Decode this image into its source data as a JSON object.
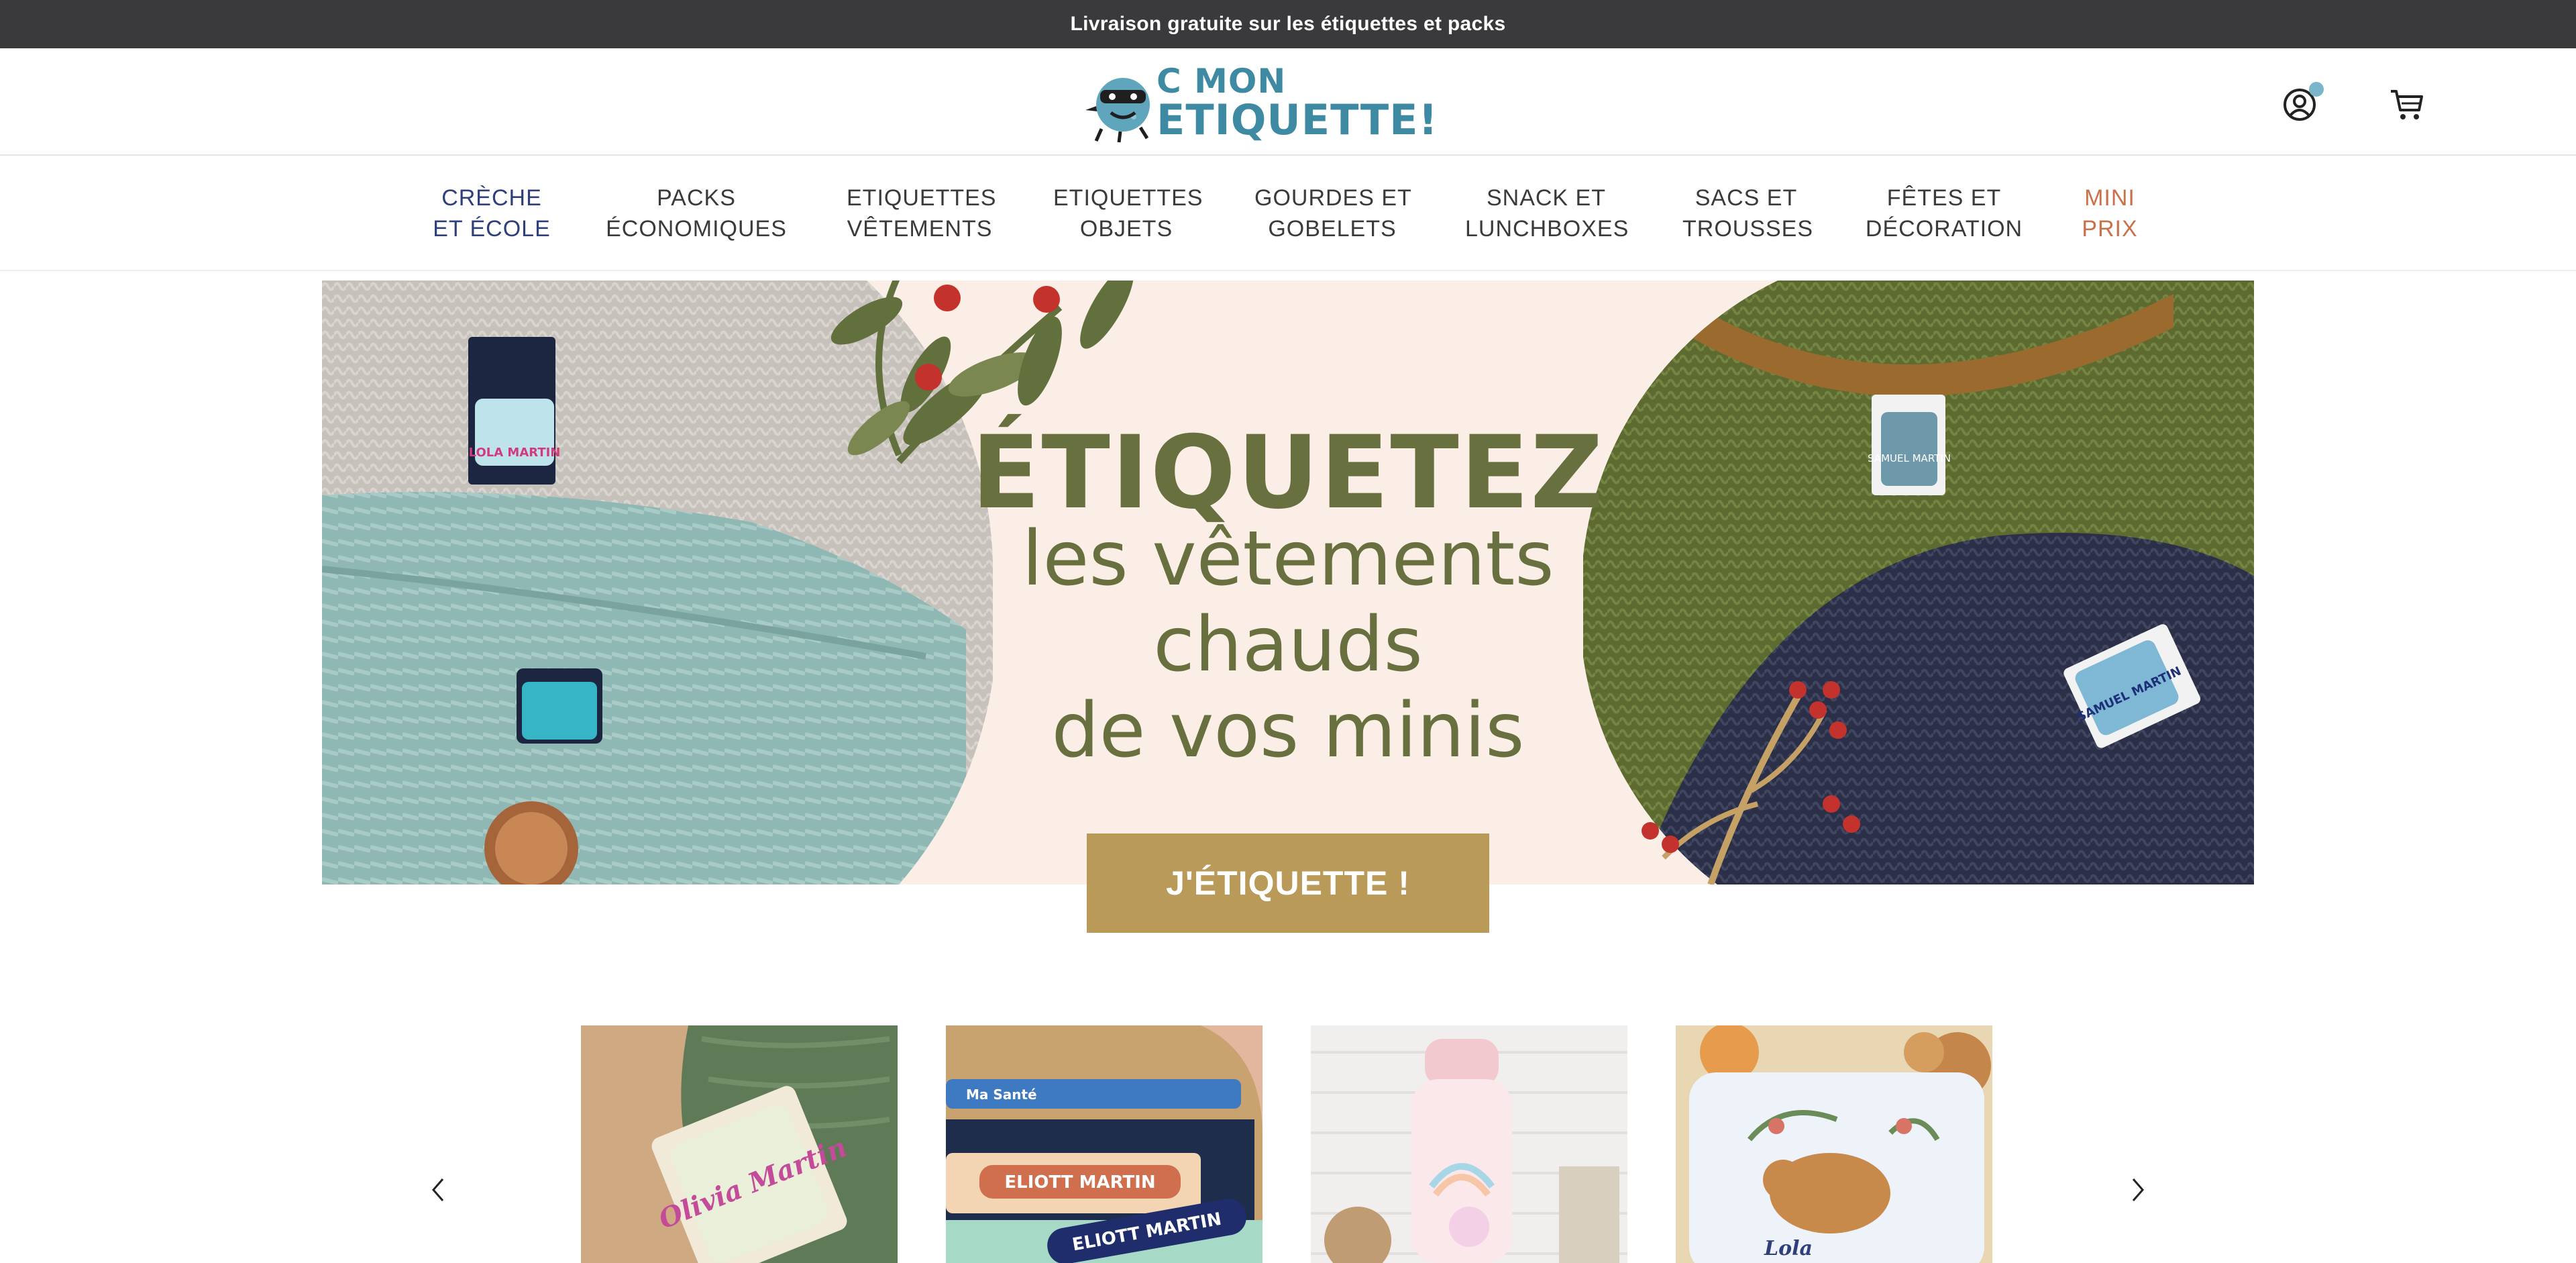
{
  "announcement": {
    "text": "Livraison gratuite sur les étiquettes et packs"
  },
  "header": {
    "logo": {
      "line1": "C MON",
      "line2": "ETIQUETTE!"
    },
    "icons": {
      "account": "user-circle-icon",
      "cart": "cart-icon"
    },
    "colors": {
      "accent": "#7ab5c9",
      "brand": "#3f8aa3"
    }
  },
  "nav": {
    "items": [
      {
        "line1": "CRÈCHE",
        "line2": "ET ÉCOLE",
        "state": "active"
      },
      {
        "line1": "PACKS",
        "line2": "ÉCONOMIQUES"
      },
      {
        "line1": "ETIQUETTES",
        "line2": "VÊTEMENTS"
      },
      {
        "line1": "ETIQUETTES",
        "line2": "OBJETS"
      },
      {
        "line1": "GOURDES ET",
        "line2": "GOBELETS"
      },
      {
        "line1": "SNACK ET",
        "line2": "LUNCHBOXES"
      },
      {
        "line1": "SACS ET",
        "line2": "TROUSSES"
      },
      {
        "line1": "FÊTES ET",
        "line2": "DÉCORATION"
      },
      {
        "line1": "MINI",
        "line2": "PRIX",
        "state": "promo"
      }
    ],
    "colors": {
      "active": "#2e3f7a",
      "promo": "#c9714b"
    }
  },
  "hero": {
    "title": "ÉTIQUETEZ",
    "line1": "les vêtements",
    "line2": "chauds",
    "line3": "de vos minis",
    "cta": "J'ÉTIQUETTE !",
    "label_left": "LOLA MARTIN",
    "label_right_top": "SAMUEL MARTIN",
    "label_right_bottom": "SAMUEL MARTIN",
    "colors": {
      "title": "#68703f",
      "cta": "#b99a58",
      "background": "#fbeee6"
    }
  },
  "carousel": {
    "prev_icon": "chevron-left-icon",
    "next_icon": "chevron-right-icon",
    "cards": [
      {
        "label": "Olivia Martin"
      },
      {
        "label_a": "ELIOTT MARTIN",
        "label_b": "ELIOTT MARTIN",
        "label_c": "Ma Santé"
      },
      {
        "label": ""
      },
      {
        "label": "Lola"
      }
    ]
  }
}
